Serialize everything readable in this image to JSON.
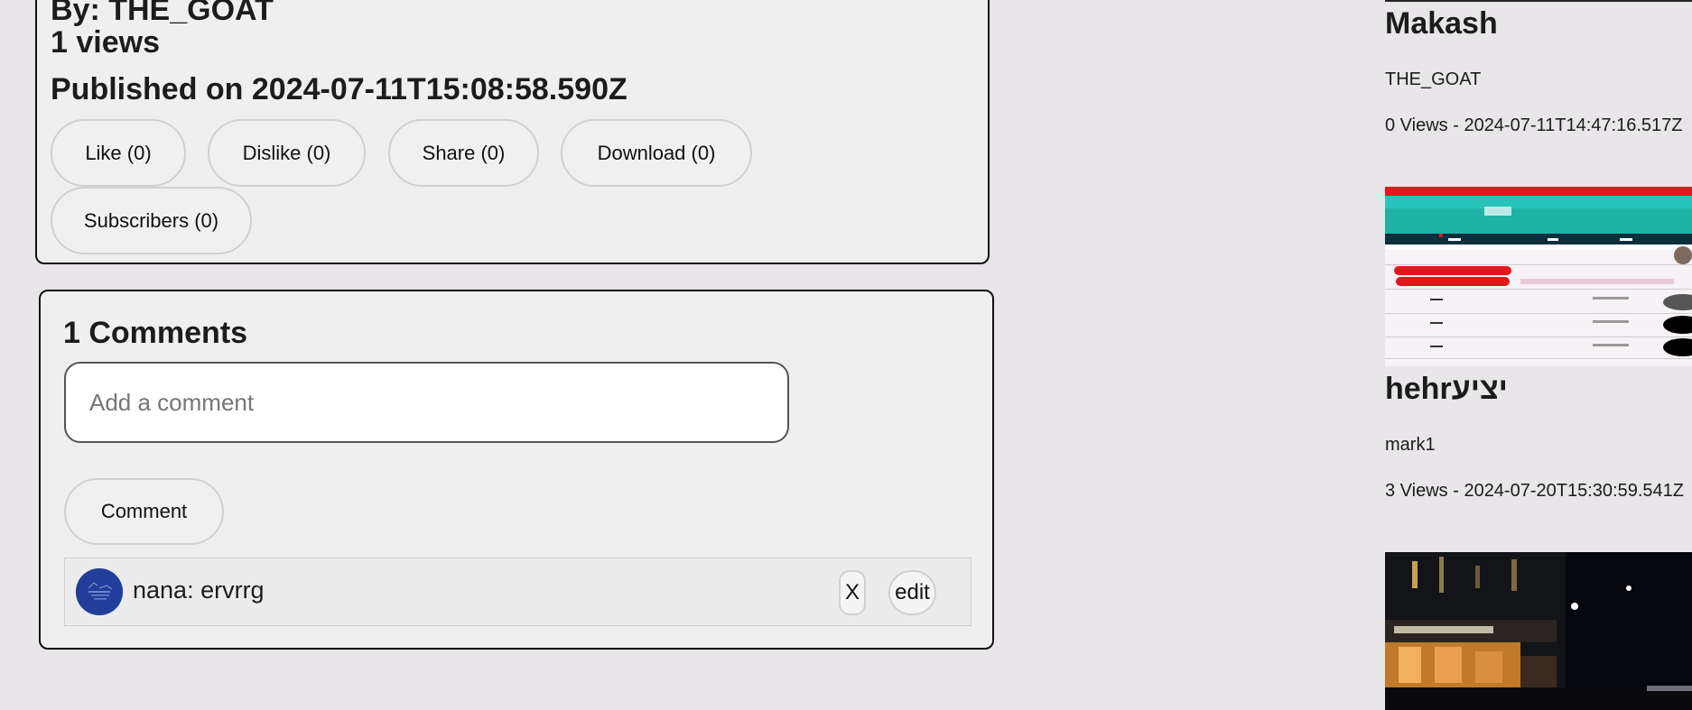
{
  "video": {
    "author_line": "By: THE_GOAT",
    "views_line": "1 views",
    "published_line": "Published on 2024-07-11T15:08:58.590Z",
    "buttons": {
      "like": "Like (0)",
      "dislike": "Dislike (0)",
      "share": "Share (0)",
      "download": "Download (0)",
      "subscribers": "Subscribers (0)"
    }
  },
  "comments": {
    "title": "1 Comments",
    "input_placeholder": "Add a comment",
    "submit_label": "Comment",
    "items": [
      {
        "text": "nana: ervrrg",
        "delete_label": "X",
        "edit_label": "edit"
      }
    ]
  },
  "sidebar": {
    "videos": [
      {
        "title": "Makash",
        "author": "THE_GOAT",
        "meta": "0 Views - 2024-07-11T14:47:16.517Z"
      },
      {
        "title": "hehrיציע",
        "author": "mark1",
        "meta": "3 Views - 2024-07-20T15:30:59.541Z"
      },
      {
        "title": "",
        "author": "",
        "meta": ""
      }
    ]
  },
  "colors": {
    "page_background": "#e8e6e8",
    "panel_background": "#efefef",
    "avatar_blue": "#213e9b",
    "thumbnail_red": "#e8141c"
  },
  "icons": {
    "avatar": "user-avatar-logo"
  }
}
